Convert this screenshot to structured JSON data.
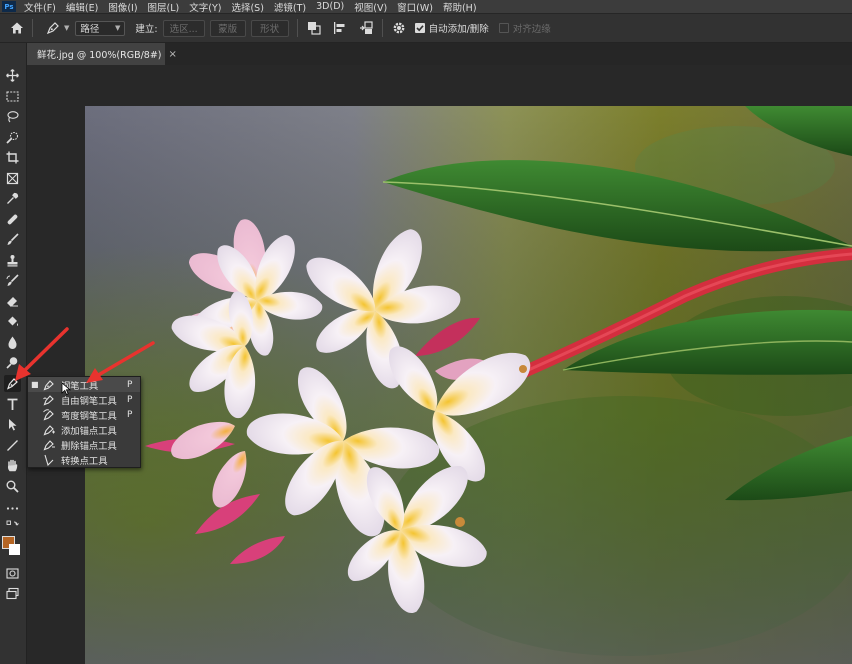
{
  "menubar": {
    "logo": "Ps",
    "items": [
      "文件(F)",
      "编辑(E)",
      "图像(I)",
      "图层(L)",
      "文字(Y)",
      "选择(S)",
      "滤镜(T)",
      "3D(D)",
      "视图(V)",
      "窗口(W)",
      "帮助(H)"
    ]
  },
  "options": {
    "mode_value": "路径",
    "make_label": "建立:",
    "selection_btn": "选区...",
    "mask_btn": "蒙版",
    "shape_btn": "形状",
    "auto_add_delete": "自动添加/删除",
    "align_edges": "对齐边缘"
  },
  "document": {
    "tab_title": "鲜花.jpg @ 100%(RGB/8#)",
    "close_glyph": "×"
  },
  "toolbar": {
    "icons": [
      "move-icon",
      "marquee-icon",
      "lasso-icon",
      "quick-select-icon",
      "crop-icon",
      "frame-icon",
      "eyedropper-icon",
      "healing-brush-icon",
      "brush-icon",
      "clone-stamp-icon",
      "history-brush-icon",
      "eraser-icon",
      "paint-bucket-icon",
      "blur-icon",
      "dodge-icon",
      "pen-icon",
      "type-icon",
      "path-select-icon",
      "line-icon",
      "hand-icon",
      "zoom-icon",
      "more-icon"
    ],
    "foreground_color": "#b56524",
    "background_color": "#ffffff"
  },
  "pen_flyout": {
    "items": [
      {
        "label": "钢笔工具",
        "key": "P",
        "selected": true,
        "icon": "pen-icon"
      },
      {
        "label": "自由钢笔工具",
        "key": "P",
        "selected": false,
        "icon": "freeform-pen-icon"
      },
      {
        "label": "弯度钢笔工具",
        "key": "P",
        "selected": false,
        "icon": "curvature-pen-icon"
      },
      {
        "label": "添加锚点工具",
        "key": "",
        "selected": false,
        "icon": "add-anchor-icon"
      },
      {
        "label": "删除锚点工具",
        "key": "",
        "selected": false,
        "icon": "delete-anchor-icon"
      },
      {
        "label": "转换点工具",
        "key": "",
        "selected": false,
        "icon": "convert-point-icon"
      }
    ]
  },
  "colors": {
    "annotation_arrow": "#e8332e"
  }
}
